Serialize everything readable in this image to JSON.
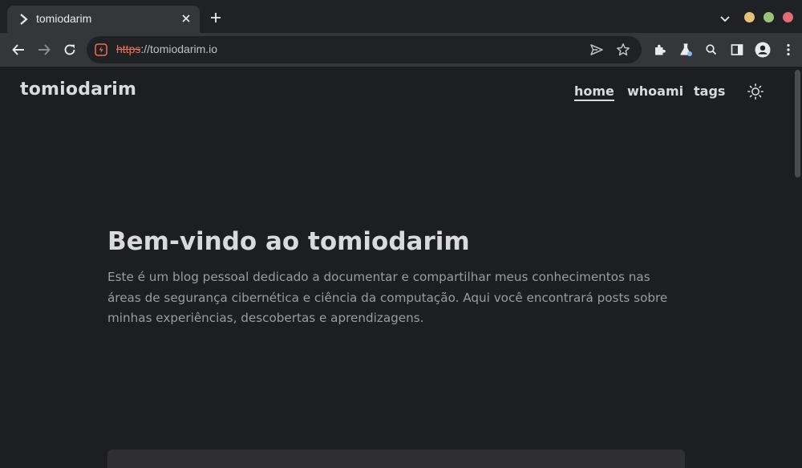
{
  "browser": {
    "tab": {
      "title": "tomiodarim"
    },
    "address_bar": {
      "scheme": "https",
      "rest": "://tomiodarim.io"
    },
    "colors": {
      "win_minimize": "#e5c07b",
      "win_maximize": "#98c379",
      "win_close": "#e06c75"
    }
  },
  "site": {
    "logo": "tomiodarim",
    "nav": [
      {
        "label": "home",
        "active": true
      },
      {
        "label": "whoami",
        "active": false
      },
      {
        "label": "tags",
        "active": false
      }
    ],
    "theme_toggle_icon": "sun-icon"
  },
  "hero": {
    "title": "Bem-vindo ao tomiodarim",
    "description": "Este é um blog pessoal dedicado a documentar e compartilhar meus conhecimentos nas áreas de segurança cibernética e ciência da computação. Aqui você encontrará posts sobre minhas experiências, descobertas e aprendizagens."
  }
}
